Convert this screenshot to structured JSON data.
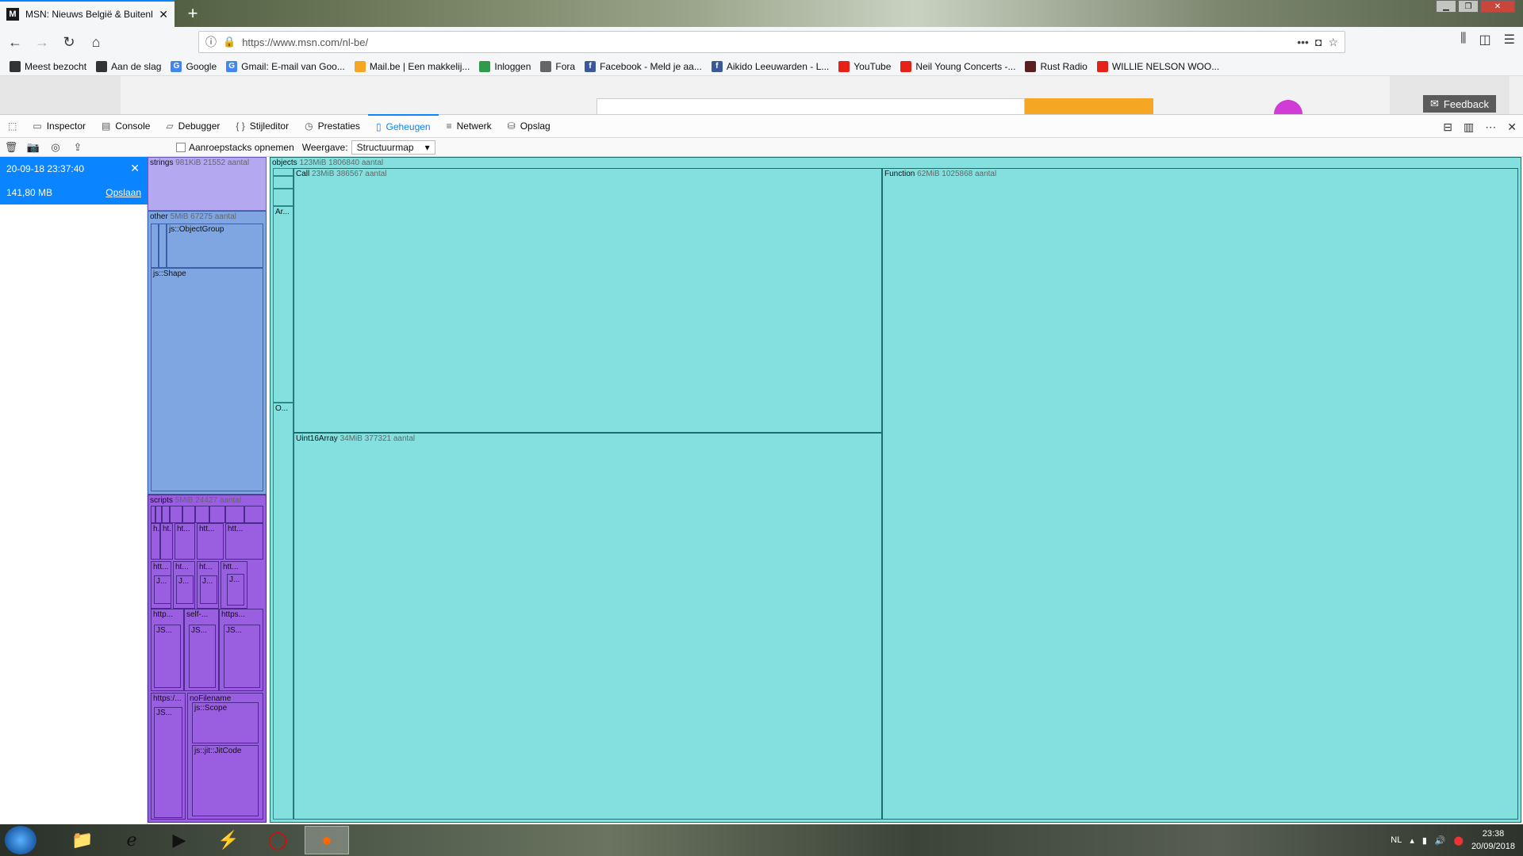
{
  "browser": {
    "tab_title": "MSN: Nieuws België & Buitenland",
    "tab_favicon": "M",
    "new_tab": "+",
    "url": "https://www.msn.com/nl-be/",
    "url_more": "•••",
    "bookmarks": [
      {
        "label": "Meest bezocht",
        "icon": "gear-icon",
        "color": "#333"
      },
      {
        "label": "Aan de slag",
        "icon": "globe-icon",
        "color": "#333"
      },
      {
        "label": "Google",
        "icon": "G",
        "color": "#4285f4"
      },
      {
        "label": "Gmail: E-mail van Goo...",
        "icon": "G",
        "color": "#4285f4"
      },
      {
        "label": "Mail.be | Een makkelij...",
        "icon": "cloud-icon",
        "color": "#f5a623"
      },
      {
        "label": "Inloggen",
        "icon": "login-icon",
        "color": "#2f9a4a"
      },
      {
        "label": "Fora",
        "icon": "folder-icon",
        "color": "#666"
      },
      {
        "label": "Facebook - Meld je aa...",
        "icon": "f",
        "color": "#3b5998"
      },
      {
        "label": "Aikido Leeuwarden - L...",
        "icon": "f",
        "color": "#3b5998"
      },
      {
        "label": "YouTube",
        "icon": "youtube-icon",
        "color": "#e62117"
      },
      {
        "label": "Neil Young Concerts -...",
        "icon": "youtube-icon",
        "color": "#e62117"
      },
      {
        "label": "Rust Radio",
        "icon": "radio-icon",
        "color": "#5a1f1f"
      },
      {
        "label": "WILLIE NELSON WOO...",
        "icon": "youtube-icon",
        "color": "#e62117"
      }
    ]
  },
  "page": {
    "feedback": "Feedback"
  },
  "devtools": {
    "tabs": [
      {
        "label": "Inspector",
        "icon": "▭",
        "active": false
      },
      {
        "label": "Console",
        "icon": "▤",
        "active": false
      },
      {
        "label": "Debugger",
        "icon": "▱",
        "active": false
      },
      {
        "label": "Stijleditor",
        "icon": "{ }",
        "active": false
      },
      {
        "label": "Prestaties",
        "icon": "◷",
        "active": false
      },
      {
        "label": "Geheugen",
        "icon": "▯",
        "active": true
      },
      {
        "label": "Netwerk",
        "icon": "≡",
        "active": false
      },
      {
        "label": "Opslag",
        "icon": "⛁",
        "active": false
      }
    ],
    "memory": {
      "record_stacks_label": "Aanroepstacks opnemen",
      "view_label": "Weergave:",
      "view_value": "Structuurmap",
      "snapshot": {
        "date": "20-09-18 23:37:40",
        "size": "141,80 MB",
        "save": "Opslaan"
      },
      "treemap": {
        "strings": {
          "name": "strings",
          "meta": "981KiB 21552 aantal"
        },
        "other": {
          "name": "other",
          "meta": "5MiB 67275 aantal"
        },
        "objectgroup": "js::ObjectGroup",
        "shape": "js::Shape",
        "scripts": {
          "name": "scripts",
          "meta": "5MiB 24427 aantal"
        },
        "scripts_labels": [
          "h...",
          "ht...",
          "ht...",
          "htt...",
          "htt...",
          "htt...",
          "ht...",
          "htt...",
          "http...",
          "self-...",
          "https...",
          "https:/...",
          "J...",
          "J...",
          "J...",
          "J...",
          "JS...",
          "JS...",
          "JS...",
          "JS..."
        ],
        "nofilename": "noFilename",
        "scope": "js::Scope",
        "jitcode": "js::jit::JitCode",
        "objects": {
          "name": "objects",
          "meta": "123MiB 1806840 aantal"
        },
        "ar": "Ar...",
        "o": "O...",
        "call": {
          "name": "Call",
          "meta": "23MiB 386567 aantal"
        },
        "function": {
          "name": "Function",
          "meta": "62MiB 1025868 aantal"
        },
        "uint16": {
          "name": "Uint16Array",
          "meta": "34MiB 377321 aantal"
        }
      }
    }
  },
  "taskbar": {
    "language": "NL",
    "time": "23:38",
    "date": "20/09/2018"
  }
}
